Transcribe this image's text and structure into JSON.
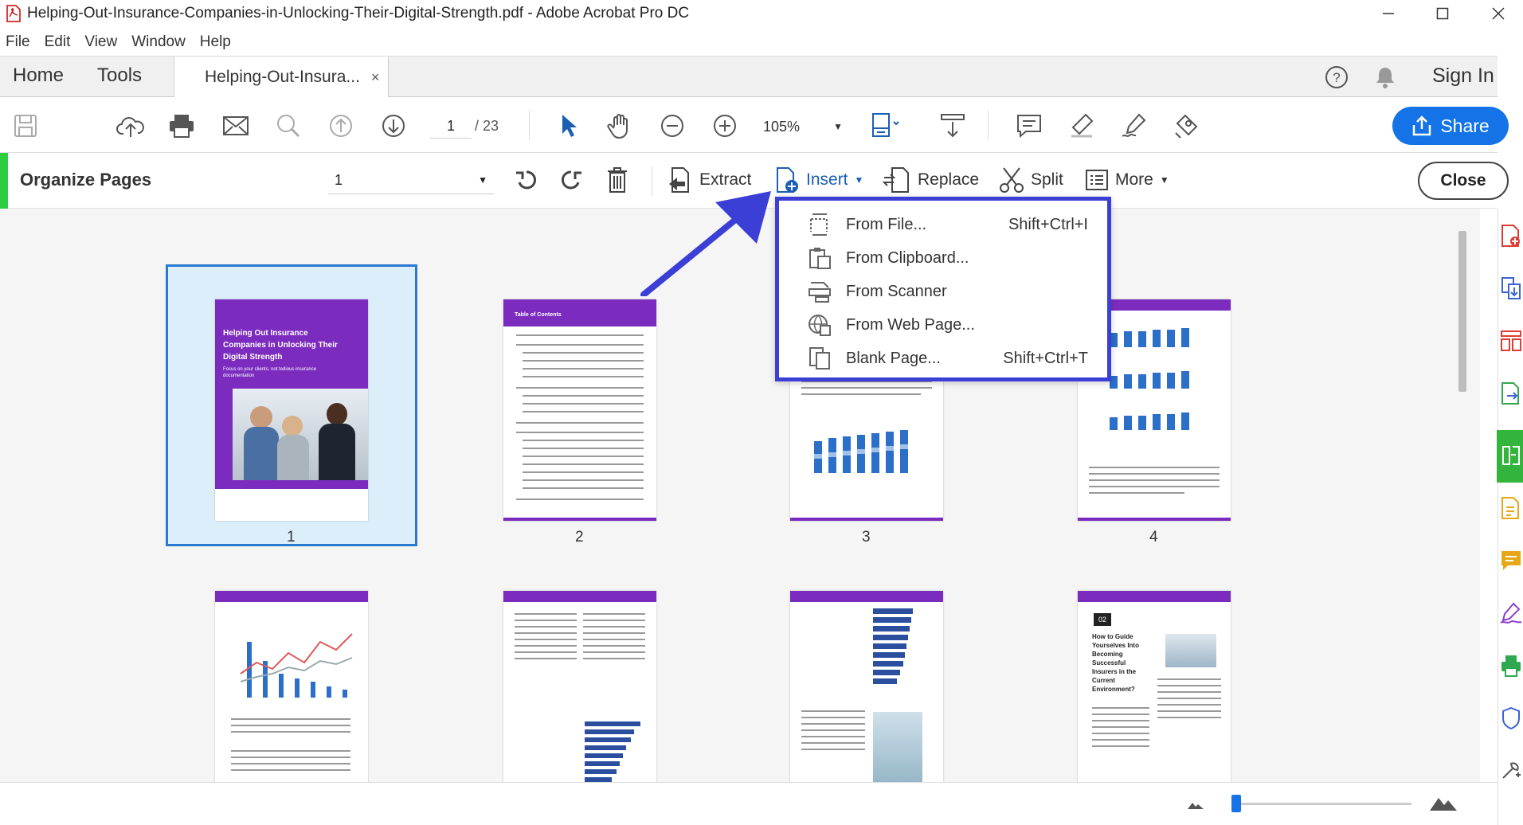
{
  "window": {
    "title": "Helping-Out-Insurance-Companies-in-Unlocking-Their-Digital-Strength.pdf - Adobe Acrobat Pro DC",
    "controls": [
      "minimize-icon",
      "maximize-icon",
      "close-icon"
    ]
  },
  "menu": [
    "File",
    "Edit",
    "View",
    "Window",
    "Help"
  ],
  "tabs": {
    "home": "Home",
    "tools": "Tools",
    "document": "Helping-Out-Insura...",
    "close_glyph": "×",
    "sign_in": "Sign In"
  },
  "toolbar": {
    "page_current": "1",
    "page_total": "/ 23",
    "zoom": "105%",
    "share_label": "Share",
    "icons": [
      "save-icon",
      "upload-cloud-icon",
      "print-icon",
      "email-icon",
      "search-icon",
      "page-up-icon",
      "page-down-icon",
      "select-cursor-icon",
      "hand-icon",
      "zoom-out-icon",
      "zoom-in-icon",
      "fit-page-icon",
      "scroll-mode-icon",
      "comment-icon",
      "highlight-icon",
      "sign-icon",
      "stamp-icon"
    ]
  },
  "organize": {
    "title": "Organize Pages",
    "range_value": "1",
    "extract": "Extract",
    "insert": "Insert",
    "replace": "Replace",
    "split": "Split",
    "more": "More",
    "close": "Close"
  },
  "insert_menu": {
    "items": [
      {
        "label": "From File...",
        "shortcut": "Shift+Ctrl+I",
        "icon": "insert-file-icon"
      },
      {
        "label": "From Clipboard...",
        "shortcut": "",
        "icon": "clipboard-icon"
      },
      {
        "label": "From Scanner",
        "shortcut": "",
        "icon": "scanner-icon"
      },
      {
        "label": "From Web Page...",
        "shortcut": "",
        "icon": "web-page-icon"
      },
      {
        "label": "Blank Page...",
        "shortcut": "Shift+Ctrl+T",
        "icon": "blank-page-icon"
      }
    ]
  },
  "pages": [
    {
      "number": "1",
      "selected": true,
      "cover_title": "Helping Out Insurance Companies in Unlocking Their Digital Strength",
      "cover_sub": "Focus on your clients, not tedious insurance documentation"
    },
    {
      "number": "2",
      "selected": false,
      "heading": "Table of Contents"
    },
    {
      "number": "3",
      "selected": false
    },
    {
      "number": "4",
      "selected": false
    },
    {
      "number": "",
      "selected": false
    },
    {
      "number": "",
      "selected": false
    },
    {
      "number": "",
      "selected": false
    },
    {
      "number": "",
      "selected": false,
      "badge": "02",
      "heading": "How to Guide Yourselves Into Becoming Successful Insurers in the Current Environment?"
    }
  ],
  "rail_icons": [
    "create-pdf-icon",
    "combine-files-icon",
    "organize-icon",
    "export-pdf-icon",
    "organize-pages-active-icon",
    "edit-pdf-icon",
    "comment-icon",
    "fill-sign-icon",
    "print-production-icon",
    "protect-icon",
    "more-tools-icon"
  ],
  "colors": {
    "accent": "#1473e6",
    "active_green": "#33b43d",
    "callout": "#3b3fd6",
    "cover_purple": "#7b2cbf"
  }
}
